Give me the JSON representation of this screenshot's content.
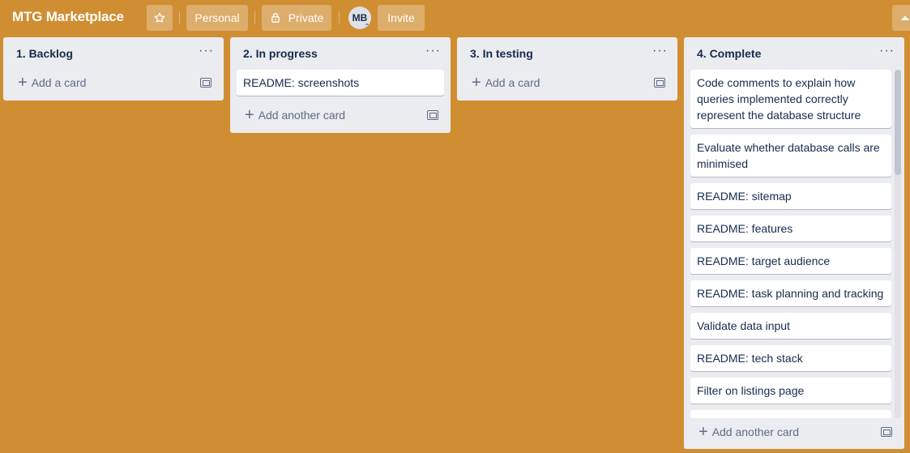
{
  "board": {
    "title": "MTG Marketplace",
    "background_color": "#d08e33"
  },
  "header": {
    "star_icon": "star-icon",
    "workspace_label": "Personal",
    "visibility_label": "Private",
    "visibility_icon": "lock-icon",
    "member_initials": "MB",
    "invite_label": "Invite"
  },
  "lists": [
    {
      "title": "1. Backlog",
      "cards": [],
      "add_label": "Add a card"
    },
    {
      "title": "2. In progress",
      "cards": [
        "README: screenshots"
      ],
      "add_label": "Add another card"
    },
    {
      "title": "3. In testing",
      "cards": [],
      "add_label": "Add a card"
    },
    {
      "title": "4. Complete",
      "cards": [
        "Code comments to explain how queries implemented correctly represent the database structure",
        "Evaluate whether database calls are minimised",
        "README: sitemap",
        "README: features",
        "README: target audience",
        "README: task planning and tracking",
        "Validate data input",
        "README: tech stack",
        "Filter on listings page"
      ],
      "add_label": "Add another card"
    }
  ]
}
